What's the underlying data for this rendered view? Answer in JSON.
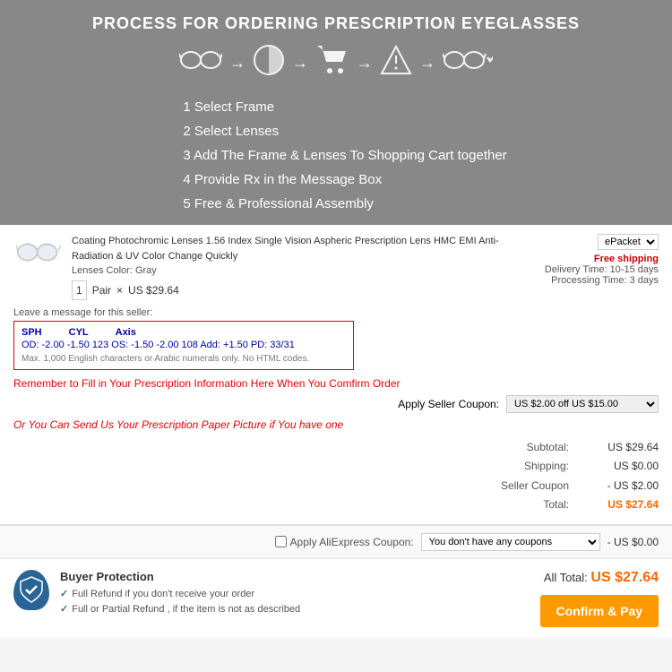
{
  "banner": {
    "title": "PROCESS FOR ORDERING PRESCRIPTION EYEGLASSES",
    "steps": [
      "1 Select Frame",
      "2 Select Lenses",
      "3 Add The Frame & Lenses To Shopping Cart together",
      "4 Provide Rx in the Message Box",
      "5 Free & Professional Assembly"
    ]
  },
  "product": {
    "name": "Coating Photochromic Lenses 1.56 Index Single Vision Aspheric Prescription Lens HMC EMI Anti-Radiation & UV Color Change Quickly",
    "lenses_color_label": "Lenses Color:",
    "lenses_color": "Gray",
    "quantity": "1",
    "unit": "Pair",
    "price": "US $29.64",
    "shipping_option": "ePacket",
    "free_shipping": "Free shipping",
    "delivery_time": "Delivery Time: 10-15 days",
    "processing_time": "Processing Time: 3 days"
  },
  "message_box": {
    "label": "Leave a message for this seller:",
    "placeholder_line1": "SPH  CYL  Axis",
    "prescription_text": "OD: -2.00 -1.50  123   OS: -1.50  -2.00  108   Add: +1.50  PD: 33/31",
    "limit_text": "Max. 1,000 English characters or Arabic numerals only. No HTML codes."
  },
  "reminder": {
    "text": "Remember to Fill in Your Prescription Information Here When You Comfirm Order",
    "alt_text": "Or You Can Send Us Your Prescription Paper Picture if You have one"
  },
  "coupon": {
    "label": "Apply Seller Coupon:",
    "value": "US $2.00 off US $15.00"
  },
  "totals": {
    "subtotal_label": "Subtotal:",
    "subtotal_value": "US $29.64",
    "shipping_label": "Shipping:",
    "shipping_value": "US $0.00",
    "seller_coupon_label": "Seller Coupon",
    "seller_coupon_value": "- US $2.00",
    "total_label": "Total:",
    "total_value": "US $27.64"
  },
  "bottom_coupon": {
    "label": "Apply AliExpress Coupon:",
    "placeholder": "You don't have any coupons",
    "discount": "- US $0.00"
  },
  "footer": {
    "buyer_protection_title": "Buyer Protection",
    "refund1": "Full Refund if you don't receive your order",
    "refund2": "Full or Partial Refund , if the item is not as described",
    "all_total_label": "All Total:",
    "all_total_value": "US $27.64",
    "confirm_btn": "Confirm & Pay"
  }
}
